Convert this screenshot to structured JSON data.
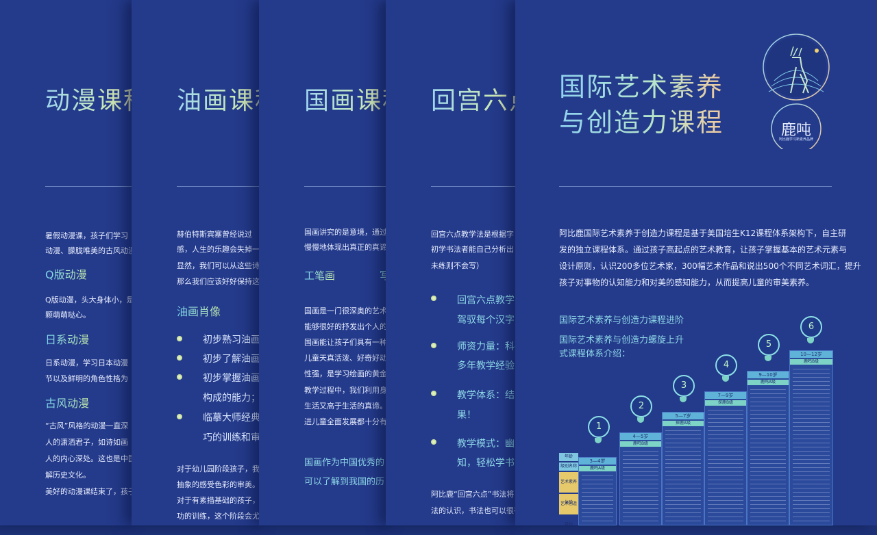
{
  "panel1": {
    "title": "动漫课程",
    "intro": [
      "暑假动漫课，孩子们学习",
      "动漫、朦胧唯美的古风动漫"
    ],
    "s1": "Q版动漫",
    "s1_text": [
      "Q版动漫，头大身体小，是",
      "颗萌萌哒心。"
    ],
    "s2": "日系动漫",
    "s2_text": [
      "日系动漫，学习日本动漫",
      "节以及鲜明的角色性格为"
    ],
    "s3": "古风动漫",
    "s3_text": [
      "“古风”风格的动漫一直深",
      "人的潇洒君子，如诗如画",
      "人的内心深处。这也是中国",
      "解历史文化。",
      "美好的动漫课结束了，孩子"
    ]
  },
  "panel2": {
    "title": "油画课程",
    "intro": [
      "赫伯特斯宾塞曾经说过",
      "感，人生的乐趣会失掉一",
      "显然，我们可以从这些诗",
      "那么我们应该好好保持这"
    ],
    "s1": "油画肖像",
    "bullets": [
      "初步熟习油画",
      "初步了解油画",
      "初步掌握油画",
      "临摹大师经典"
    ],
    "bullet_cont": [
      "构成的能力；",
      "巧的训练和审"
    ],
    "outro": [
      "对于幼儿园阶段孩子，我",
      "抽象的感受色彩的审美。",
      "对于有素描基础的孩子，",
      "功的训练，这个阶段会尤"
    ]
  },
  "panel3": {
    "title": "国画课程",
    "intro": [
      "国画讲究的是意境，通过",
      "慢慢地体现出真正的真谛"
    ],
    "tab1": "工笔画",
    "tab2": "写",
    "body": [
      "国画是一门很深奥的艺术",
      "能够很好的抒发出个人的",
      "国画能让孩子们具有一种",
      "儿童天真活泼、好奇好动",
      "性强，是学习绘画的黄金",
      "教学过程中，我们利用身",
      "生活又高于生活的真谛。",
      "进儿童全面发展都十分有"
    ],
    "outro": [
      "国画作为中国优秀的",
      "可以了解到我国的历"
    ]
  },
  "panel4": {
    "title": "回宫六点",
    "intro": [
      "回宫六点教学法是根据字",
      "初学书法者能自己分析出",
      "未练则不会写）"
    ],
    "bullets": [
      "回宫六点教学",
      "师资力量：科研",
      "教学体系：结合",
      "教学模式：幽默"
    ],
    "bullet_cont": [
      "驾驭每个汉字的",
      "多年教学经验",
      "果！",
      "知，轻松学书法"
    ],
    "outro": [
      "阿比鹿“回宫六点”书法将",
      "法的认识，书法也可以很有"
    ]
  },
  "panel5": {
    "title_line1": "国际艺术素养",
    "title_line2": "与创造力课程",
    "logo_text": "鹿吨",
    "logo_sub": "阿比鹿学习新素养品牌",
    "body": [
      "阿比鹿国际艺术素养于创造力课程是基于美国培生K12课程体系架构下，自主研",
      "发的独立课程体系。通过孩子高起点的艺术教育，让孩子掌握基本的艺术元素与",
      "设计原则，认识200多位艺术家，300幅艺术作品和说出500个不同艺术词汇，提升",
      "孩子对事物的认知能力和对美的感知能力，从而提高儿童的审美素养。"
    ],
    "link1": "国际艺术素养与创造力课程进阶",
    "link2_line1": "国际艺术素养与创造力螺旋上升",
    "link2_line2": "式课程体系介绍：",
    "steps": [
      {
        "num": "1",
        "age": "3—4岁",
        "level": "鹿鸣A级"
      },
      {
        "num": "2",
        "age": "4—5岁",
        "level": "鹿鸣B级"
      },
      {
        "num": "3",
        "age": "5—7岁",
        "level": "探鹿A级"
      },
      {
        "num": "4",
        "age": "7—9岁",
        "level": "探鹿B级"
      },
      {
        "num": "5",
        "age": "9—10岁",
        "level": "鹿鸣A级"
      },
      {
        "num": "6",
        "age": "10—12岁",
        "level": "鹿鸣B级"
      }
    ],
    "table_labels": [
      "年龄",
      "级别名称",
      "艺术素养体验",
      "艺术创造目标"
    ]
  }
}
